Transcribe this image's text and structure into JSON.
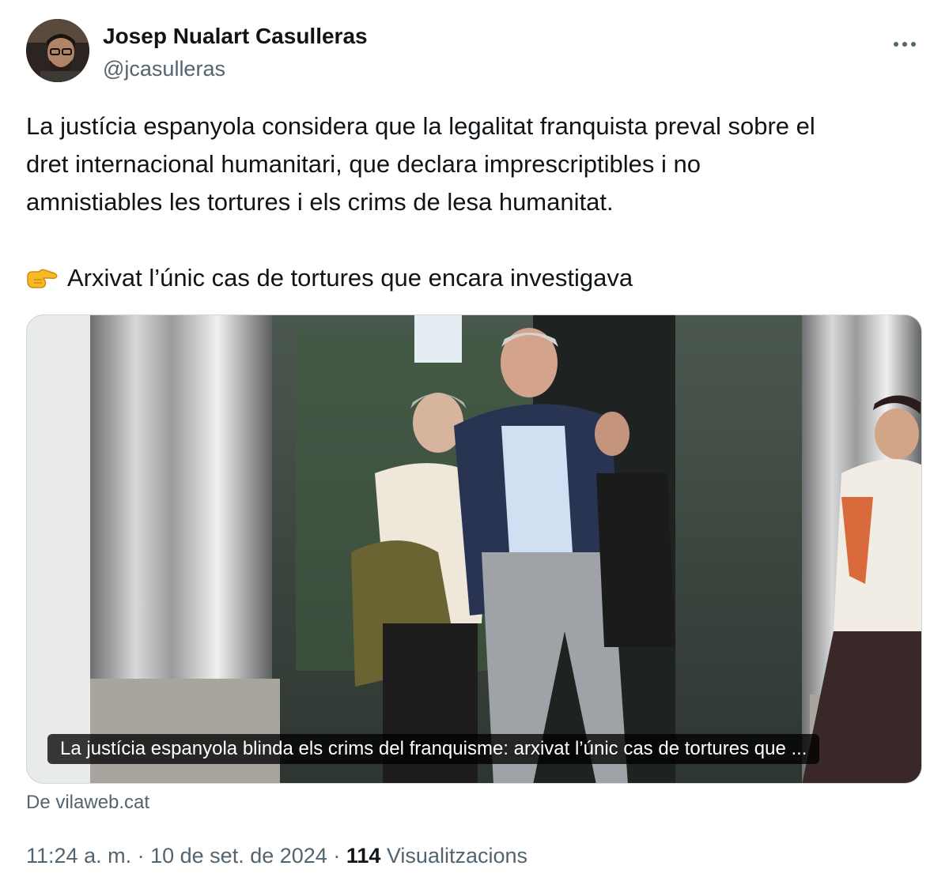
{
  "author": {
    "name": "Josep Nualart Casulleras",
    "handle": "@jcasulleras"
  },
  "menu": {
    "icon": "more-horizontal-icon"
  },
  "tweet": {
    "lines": [
      "La justícia espanyola considera que la legalitat franquista preval sobre el",
      "dret internacional humanitari, que declara imprescriptibles i no",
      "amnistiables les tortures i els crims de lesa humanitat."
    ],
    "highlight_emoji": "backhand-index-pointing-right-icon",
    "highlight_text": "Arxivat l’únic cas de tortures que encara investigava"
  },
  "card": {
    "caption": "La justícia espanyola blinda els crims del franquisme: arxivat l’únic cas de tortures que ...",
    "source": "De vilaweb.cat"
  },
  "meta": {
    "time": "11:24 a. m.",
    "separator": "·",
    "date": "10 de set. de 2024",
    "views_count": "114",
    "views_label": "Visualitzacions"
  },
  "colors": {
    "text_primary": "#0f1419",
    "text_secondary": "#536471",
    "border": "#cfd9de"
  }
}
